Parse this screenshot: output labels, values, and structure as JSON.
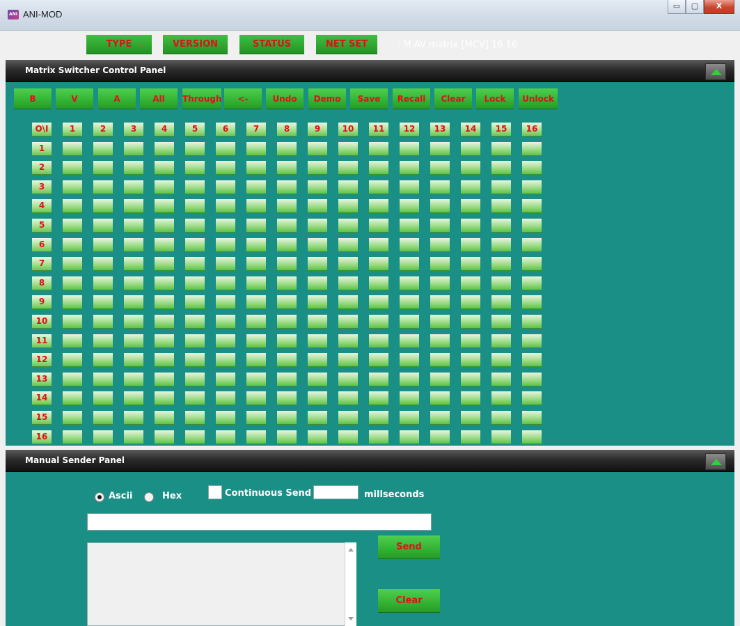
{
  "window": {
    "title": "ANI-MOD",
    "logo_text": "ANI",
    "minimize_glyph": "▭",
    "maximize_glyph": "▢",
    "close_glyph": "X"
  },
  "toolbar": {
    "buttons": [
      "TYPE",
      "VERSION",
      "STATUS",
      "NET SET"
    ],
    "device_info": ":  M  AV matrix [MCV] 16 16"
  },
  "matrix_panel": {
    "title": "Matrix Switcher Control Panel",
    "controls": [
      "B",
      "V",
      "A",
      "All",
      "Through",
      "<-",
      "Undo",
      "Demo",
      "Save",
      "Recall",
      "Clear",
      "Lock",
      "Unlock"
    ],
    "corner_label": "O\\I",
    "input_labels": [
      "1",
      "2",
      "3",
      "4",
      "5",
      "6",
      "7",
      "8",
      "9",
      "10",
      "11",
      "12",
      "13",
      "14",
      "15",
      "16"
    ],
    "output_labels": [
      "1",
      "2",
      "3",
      "4",
      "5",
      "6",
      "7",
      "8",
      "9",
      "10",
      "11",
      "12",
      "13",
      "14",
      "15",
      "16"
    ]
  },
  "sender_panel": {
    "title": "Manual Sender Panel",
    "mode_ascii": "Ascii",
    "mode_hex": "Hex",
    "selected_mode": "Ascii",
    "continuous_label": "Continuous Send",
    "continuous_checked": false,
    "interval_value": "",
    "interval_unit": "millseconds",
    "command_value": "",
    "log_value": "",
    "send_label": "Send",
    "clear_label": "Clear"
  },
  "colors": {
    "panel_bg": "#1a8f86",
    "button_green": "#33b233",
    "label_red": "#e0101a",
    "header_dark": "#1e1e1e"
  },
  "icons": {
    "collapse": "triangle-up-icon"
  }
}
